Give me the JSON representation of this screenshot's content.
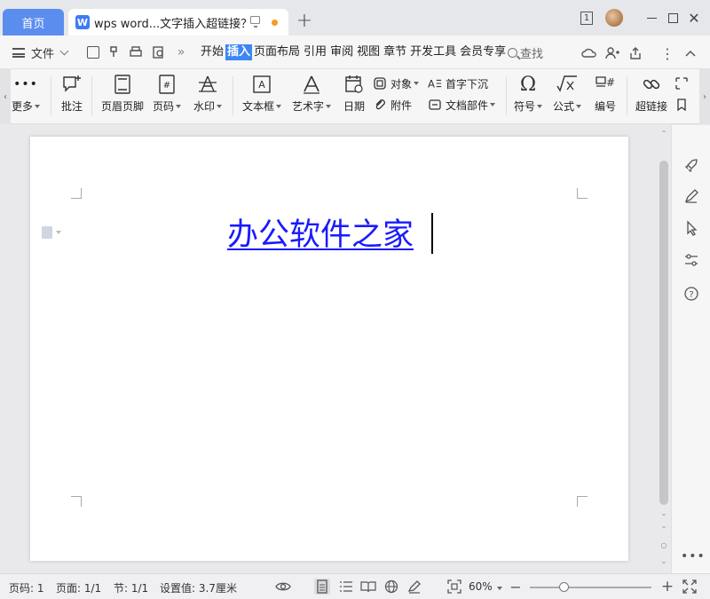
{
  "titlebar": {
    "home_tab": "首页",
    "doc_tab_title": "wps word...文字插入超链接？",
    "doc_logo_letter": "W",
    "new_tab": "+",
    "badge": "1",
    "close_glyph": "✕",
    "modified_dot_color": "#f59a23"
  },
  "menubar": {
    "file_label": "文件",
    "overflow": "»",
    "items": [
      "开始",
      "插入",
      "页面布局",
      "引用",
      "审阅",
      "视图",
      "章节",
      "开发工具",
      "会员专享"
    ],
    "active_item": "插入",
    "search_label": "查找"
  },
  "ribbon": {
    "more": "更多",
    "comment": "批注",
    "header_footer": "页眉页脚",
    "page_number": "页码",
    "watermark": "水印",
    "textbox": "文本框",
    "wordart": "艺术字",
    "date": "日期",
    "object": "对象",
    "attachment": "附件",
    "drop_cap": "首字下沉",
    "doc_parts": "文档部件",
    "symbol": "符号",
    "formula": "公式",
    "numbering": "编号",
    "hyperlink": "超链接"
  },
  "document": {
    "hyperlink_text": "办公软件之家",
    "hyperlink_color": "#1a1aff"
  },
  "statusbar": {
    "page_num": "页码: 1",
    "pages": "页面: 1/1",
    "section": "节: 1/1",
    "setting": "设置值: 3.7厘米",
    "zoom": "60%",
    "zoom_minus": "−",
    "zoom_plus": "+"
  },
  "sidepanel": {
    "more": "•••"
  },
  "colors": {
    "accent": "#3d86f5",
    "home_tab": "#5b8def"
  }
}
